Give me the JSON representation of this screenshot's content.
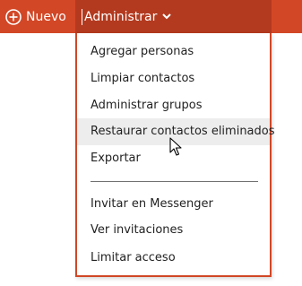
{
  "toolbar": {
    "new_label": "Nuevo",
    "manage_label": "Administrar",
    "icons": {
      "new": "plus-circle-icon",
      "manage": "chevron-down-icon"
    },
    "colors": {
      "bar": "#d24726",
      "active_tab": "#b33a1f"
    }
  },
  "menu": {
    "items": [
      {
        "label": "Agregar personas"
      },
      {
        "label": "Limpiar contactos"
      },
      {
        "label": "Administrar grupos"
      },
      {
        "label": "Restaurar contactos eliminados",
        "hovered": true
      },
      {
        "label": "Exportar"
      },
      {
        "label": "Invitar en Messenger"
      },
      {
        "label": "Ver invitaciones"
      },
      {
        "label": "Limitar acceso"
      }
    ]
  }
}
